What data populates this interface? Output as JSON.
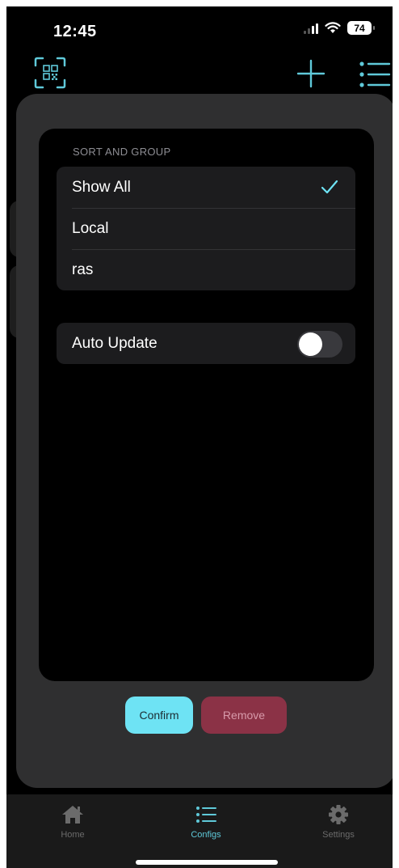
{
  "status_bar": {
    "time": "12:45",
    "battery": "74"
  },
  "colors": {
    "accent": "#6ee3f4",
    "danger": "#8b3246",
    "sheet": "#2f2f30",
    "card": "#1c1c1e"
  },
  "nav": {
    "icons": [
      "qr-code-icon",
      "plus-icon",
      "list-icon"
    ]
  },
  "sheet": {
    "section_header": "SORT AND GROUP",
    "options": [
      {
        "label": "Show All",
        "selected": true
      },
      {
        "label": "Local",
        "selected": false
      },
      {
        "label": "ras",
        "selected": false
      }
    ],
    "auto_update": {
      "label": "Auto Update",
      "enabled": false
    },
    "confirm_label": "Confirm",
    "remove_label": "Remove"
  },
  "tabbar": {
    "items": [
      {
        "label": "Home",
        "icon": "home-icon",
        "active": false
      },
      {
        "label": "Configs",
        "icon": "list-icon",
        "active": true
      },
      {
        "label": "Settings",
        "icon": "gear-icon",
        "active": false
      }
    ]
  }
}
